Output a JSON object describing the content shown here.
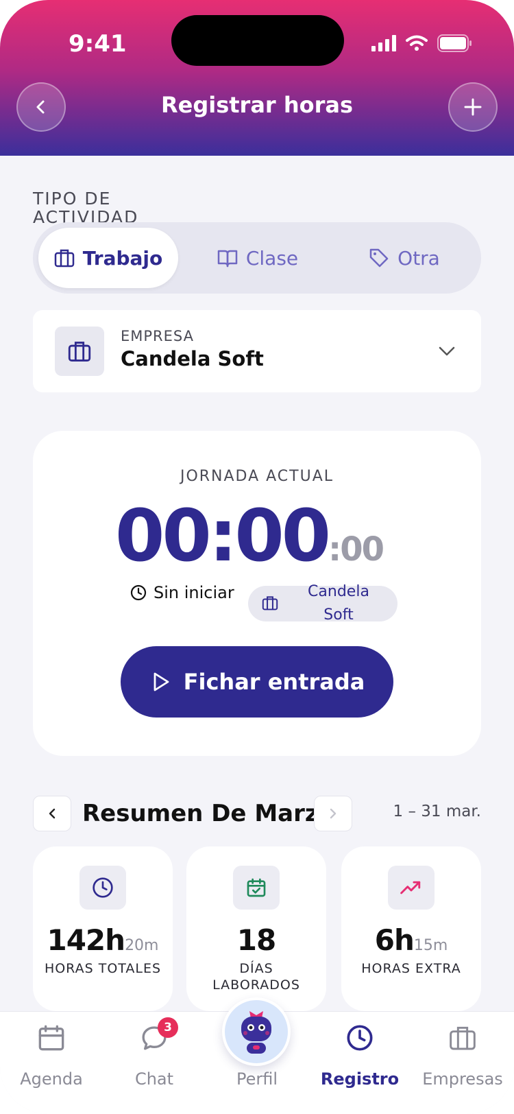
{
  "status_bar": {
    "time": "9:41"
  },
  "header": {
    "title": "Registrar horas"
  },
  "activity": {
    "label": "TIPO DE ACTIVIDAD",
    "options": [
      {
        "label": "Trabajo",
        "icon": "briefcase-icon",
        "active": true
      },
      {
        "label": "Clase",
        "icon": "book-icon",
        "active": false
      },
      {
        "label": "Otra",
        "icon": "tag-icon",
        "active": false
      }
    ]
  },
  "company": {
    "label": "EMPRESA",
    "name": "Candela Soft"
  },
  "timer": {
    "label": "JORNADA ACTUAL",
    "value": "00:00",
    "seconds": ":00",
    "status": "Sin iniciar",
    "company_chip": "Candela Soft",
    "action": "Fichar entrada"
  },
  "summary": {
    "title": "Resumen De Marzo",
    "range": "1 – 31 mar.",
    "stats": [
      {
        "value": "142h",
        "unit": "20m",
        "label": "HORAS TOTALES",
        "icon": "clock-icon",
        "color": "#2f2a8f"
      },
      {
        "value": "18",
        "unit": "",
        "label": "DÍAS LABORADOS",
        "icon": "calendar-check-icon",
        "color": "#1f8a5b"
      },
      {
        "value": "6h",
        "unit": "15m",
        "label": "HORAS EXTRA",
        "icon": "trending-up-icon",
        "color": "#e62e73"
      }
    ]
  },
  "nav": {
    "items": [
      {
        "label": "Agenda",
        "icon": "calendar-icon"
      },
      {
        "label": "Chat",
        "icon": "chat-icon",
        "badge": "3"
      },
      {
        "label": "Perfil",
        "icon": "robot-avatar"
      },
      {
        "label": "Registro",
        "icon": "clock-icon",
        "active": true
      },
      {
        "label": "Empresas",
        "icon": "briefcase-icon"
      }
    ]
  },
  "colors": {
    "primary": "#2f2a8f",
    "accent": "#e62e73",
    "background": "#f4f4f9"
  }
}
